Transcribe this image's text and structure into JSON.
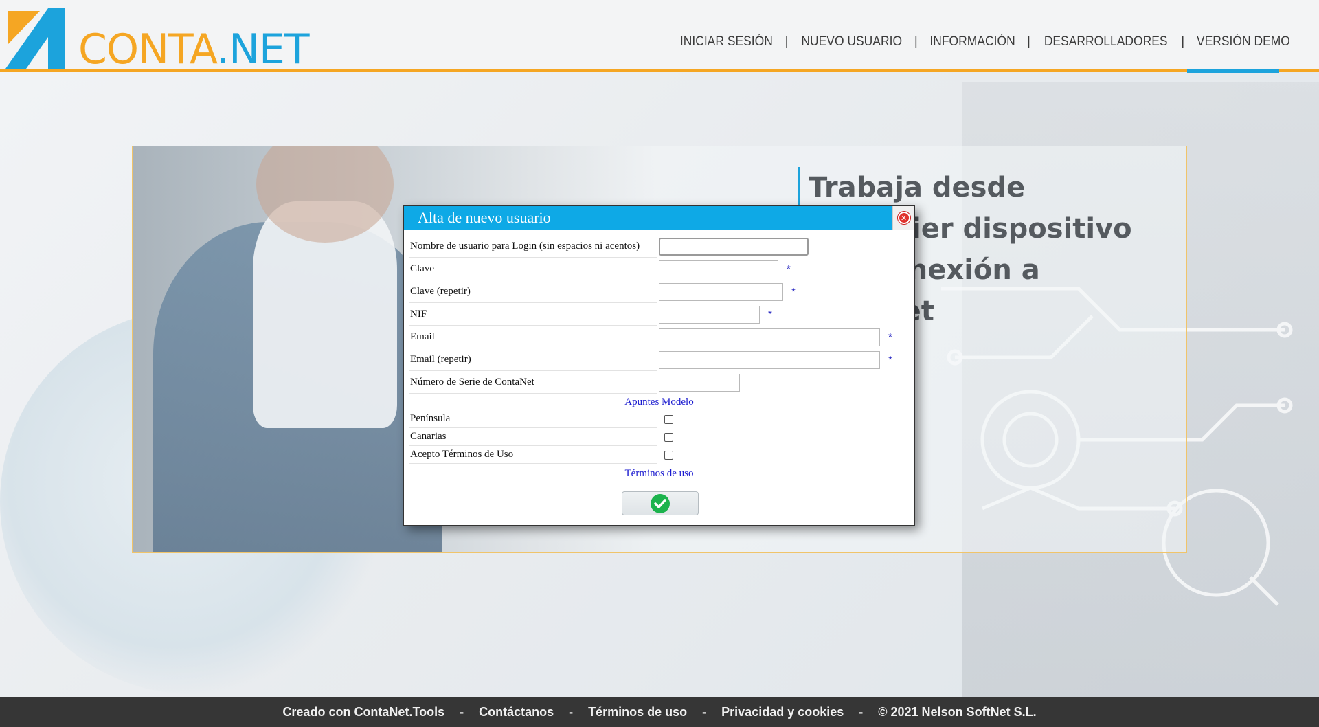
{
  "header": {
    "logo": {
      "part1": "CONTA",
      "part2": ".NET"
    },
    "nav": [
      "INICIAR SESIÓN",
      "NUEVO USUARIO",
      "INFORMACIÓN",
      "DESARROLLADORES",
      "VERSIÓN DEMO"
    ],
    "nav_separator": "|"
  },
  "hero": {
    "title": "Trabaja desde cualquier dispositivo con conexión a internet"
  },
  "modal": {
    "title": "Alta de nuevo usuario",
    "close_icon": "close-icon",
    "fields": [
      {
        "label": "Nombre de usuario para Login (sin espacios ni acentos)",
        "value": "",
        "required": ""
      },
      {
        "label": "Clave",
        "value": "",
        "required": "*"
      },
      {
        "label": "Clave (repetir)",
        "value": "",
        "required": "*"
      },
      {
        "label": "NIF",
        "value": "",
        "required": "*"
      },
      {
        "label": "Email",
        "value": "",
        "required": "*"
      },
      {
        "label": "Email (repetir)",
        "value": "",
        "required": "*"
      },
      {
        "label": "Número de Serie de ContaNet",
        "value": "",
        "required": ""
      }
    ],
    "section_link": "Apuntes Modelo",
    "checkboxes": [
      {
        "label": "Península",
        "checked": false
      },
      {
        "label": "Canarias",
        "checked": false
      },
      {
        "label": "Acepto Términos de Uso",
        "checked": false
      }
    ],
    "terms_link": "Términos de uso",
    "submit_icon": "check-icon"
  },
  "footer": {
    "items": [
      "Creado con ContaNet.Tools",
      "Contáctanos",
      "Términos de uso",
      "Privacidad y cookies",
      "© 2021 Nelson SoftNet S.L."
    ],
    "separator": "-"
  },
  "colors": {
    "brand_orange": "#f5a623",
    "brand_blue": "#1ca3dc",
    "modal_header": "#0ea9e6",
    "footer_bg": "#363636"
  }
}
